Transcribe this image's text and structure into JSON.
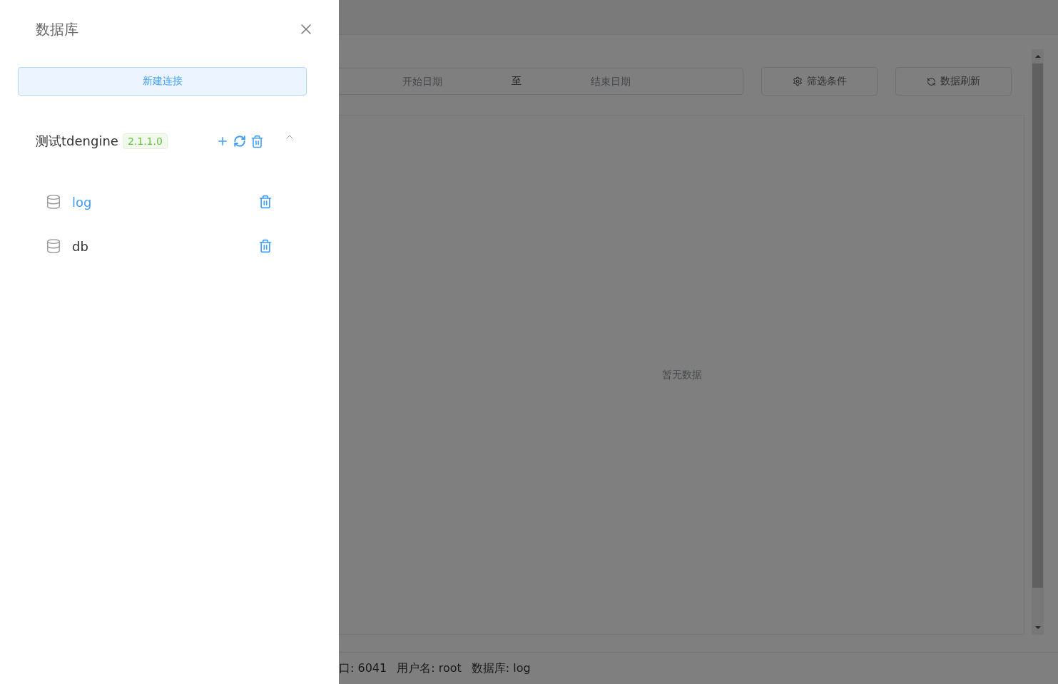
{
  "drawer": {
    "title": "数据库",
    "new_connection_button": "新建连接",
    "connections": [
      {
        "name": "测试tdengine",
        "version": "2.1.1.0",
        "expanded": true,
        "databases": [
          {
            "name": "log",
            "selected": true
          },
          {
            "name": "db",
            "selected": false
          }
        ]
      }
    ]
  },
  "toolbar": {
    "date_range": {
      "start_placeholder": "开始日期",
      "separator": "至",
      "end_placeholder": "结束日期"
    },
    "filter_button": "筛选条件",
    "refresh_button": "数据刷新"
  },
  "table": {
    "empty_text": "暂无数据"
  },
  "status_bar": [
    {
      "label": "口:",
      "value": "6041"
    },
    {
      "label": "用户名:",
      "value": "root"
    },
    {
      "label": "数据库:",
      "value": "log"
    }
  ]
}
